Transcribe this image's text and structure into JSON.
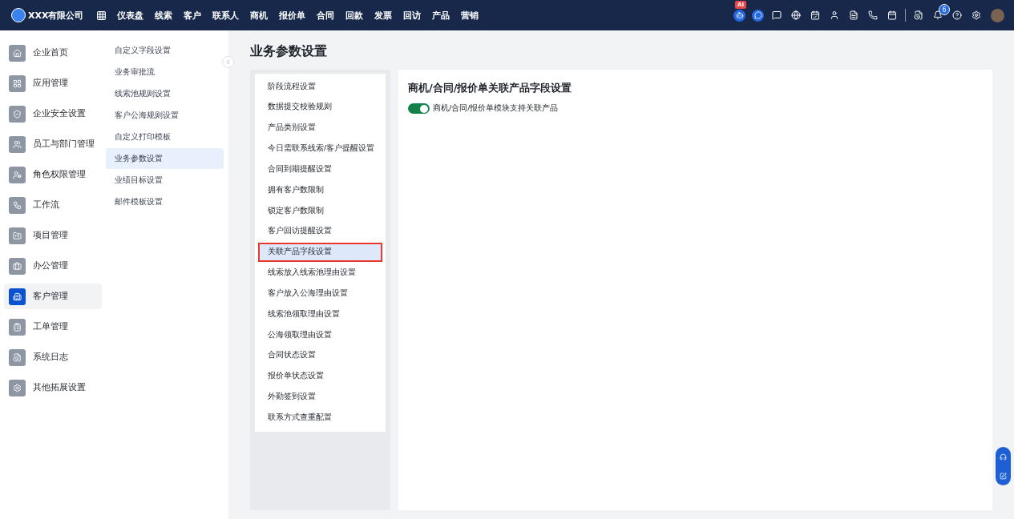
{
  "top_bar": {
    "company": "XXX有限公司",
    "nav": [
      {
        "label": "仪表盘"
      },
      {
        "label": "线索"
      },
      {
        "label": "客户"
      },
      {
        "label": "联系人"
      },
      {
        "label": "商机"
      },
      {
        "label": "报价单"
      },
      {
        "label": "合同"
      },
      {
        "label": "回款"
      },
      {
        "label": "发票"
      },
      {
        "label": "回访"
      },
      {
        "label": "产品"
      },
      {
        "label": "营销"
      }
    ],
    "ai_badge": "AI",
    "notification_count": "6"
  },
  "sidebar": {
    "items": [
      {
        "label": "企业首页",
        "selected": false
      },
      {
        "label": "应用管理",
        "selected": false
      },
      {
        "label": "企业安全设置",
        "selected": false
      },
      {
        "label": "员工与部门管理",
        "selected": false
      },
      {
        "label": "角色权限管理",
        "selected": false
      },
      {
        "label": "工作流",
        "selected": false
      },
      {
        "label": "项目管理",
        "selected": false
      },
      {
        "label": "办公管理",
        "selected": false
      },
      {
        "label": "客户管理",
        "selected": true
      },
      {
        "label": "工单管理",
        "selected": false
      },
      {
        "label": "系统日志",
        "selected": false
      },
      {
        "label": "其他拓展设置",
        "selected": false
      }
    ]
  },
  "submenu": {
    "items": [
      {
        "label": "自定义字段设置",
        "selected": false
      },
      {
        "label": "业务审批流",
        "selected": false
      },
      {
        "label": "线索池规则设置",
        "selected": false
      },
      {
        "label": "客户公海规则设置",
        "selected": false
      },
      {
        "label": "自定义打印模板",
        "selected": false
      },
      {
        "label": "业务参数设置",
        "selected": true
      },
      {
        "label": "业绩目标设置",
        "selected": false
      },
      {
        "label": "邮件模板设置",
        "selected": false
      }
    ]
  },
  "page_title": "业务参数设置",
  "settings_list": {
    "items": [
      {
        "label": "阶段流程设置",
        "selected": false
      },
      {
        "label": "数据提交校验规则",
        "selected": false
      },
      {
        "label": "产品类别设置",
        "selected": false
      },
      {
        "label": "今日需联系线索/客户提醒设置",
        "selected": false
      },
      {
        "label": "合同到期提醒设置",
        "selected": false
      },
      {
        "label": "拥有客户数限制",
        "selected": false
      },
      {
        "label": "锁定客户数限制",
        "selected": false
      },
      {
        "label": "客户回访提醒设置",
        "selected": false
      },
      {
        "label": "关联产品字段设置",
        "selected": true
      },
      {
        "label": "线索放入线索池理由设置",
        "selected": false
      },
      {
        "label": "客户放入公海理由设置",
        "selected": false
      },
      {
        "label": "线索池领取理由设置",
        "selected": false
      },
      {
        "label": "公海领取理由设置",
        "selected": false
      },
      {
        "label": "合同状态设置",
        "selected": false
      },
      {
        "label": "报价单状态设置",
        "selected": false
      },
      {
        "label": "外勤签到设置",
        "selected": false
      },
      {
        "label": "联系方式查重配置",
        "selected": false
      }
    ]
  },
  "panel": {
    "title": "商机/合同/报价单关联产品字段设置",
    "toggle": {
      "label": "商机/合同/报价单模块支持关联产品",
      "on": true
    }
  }
}
